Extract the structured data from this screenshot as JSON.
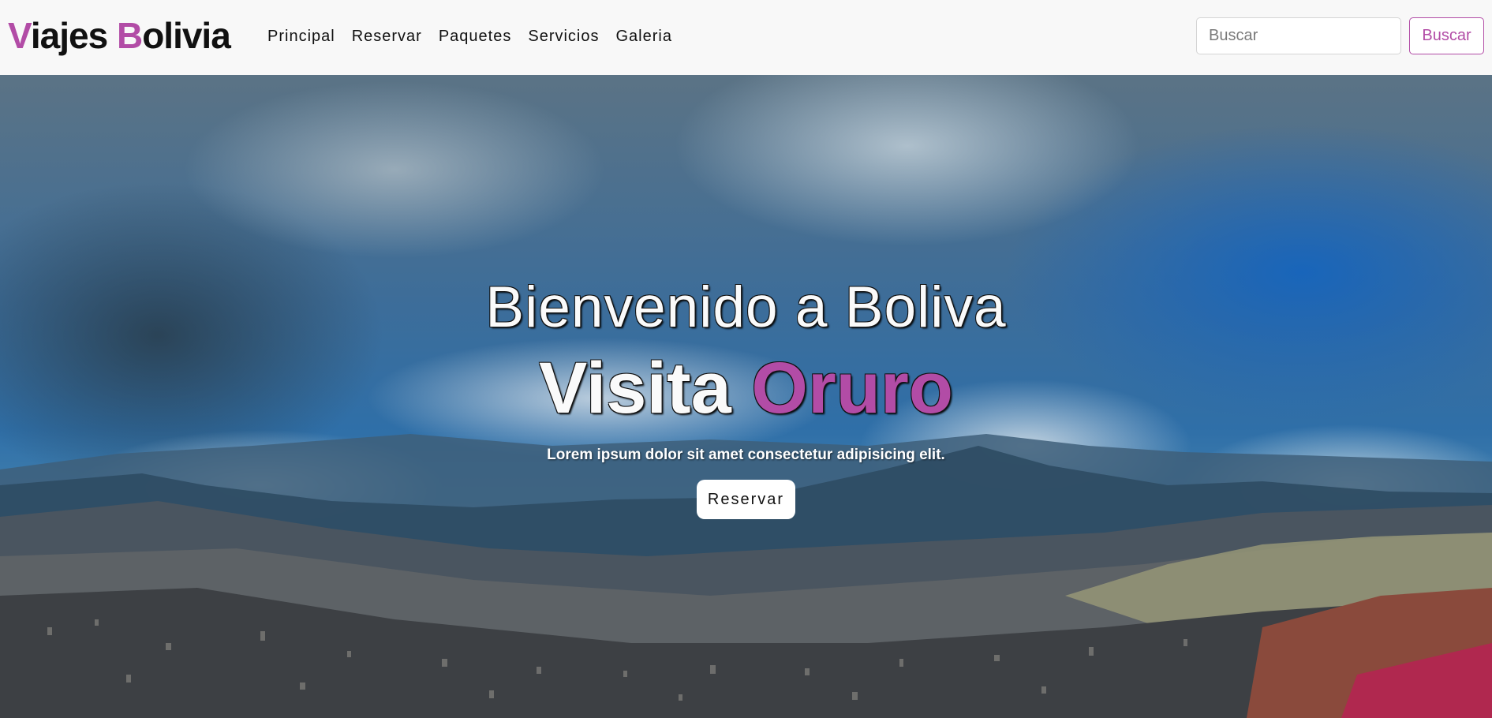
{
  "brand": {
    "first_initial": "V",
    "first_rest": "iajes ",
    "second_initial": "B",
    "second_rest": "olivia"
  },
  "nav": {
    "items": [
      {
        "label": "Principal"
      },
      {
        "label": "Reservar"
      },
      {
        "label": "Paquetes"
      },
      {
        "label": "Servicios"
      },
      {
        "label": "Galeria"
      }
    ]
  },
  "search": {
    "placeholder": "Buscar",
    "value": "",
    "button_label": "Buscar"
  },
  "hero": {
    "title": "Bienvenido a Boliva",
    "subtitle_plain": "Visita ",
    "subtitle_accent": "Oruro",
    "text": "Lorem ipsum dolor sit amet consectetur adipisicing elit.",
    "button_label": "Reservar"
  },
  "colors": {
    "accent": "#b24ca6",
    "navbar_bg": "#f8f8f8",
    "text_dark": "#111111"
  }
}
